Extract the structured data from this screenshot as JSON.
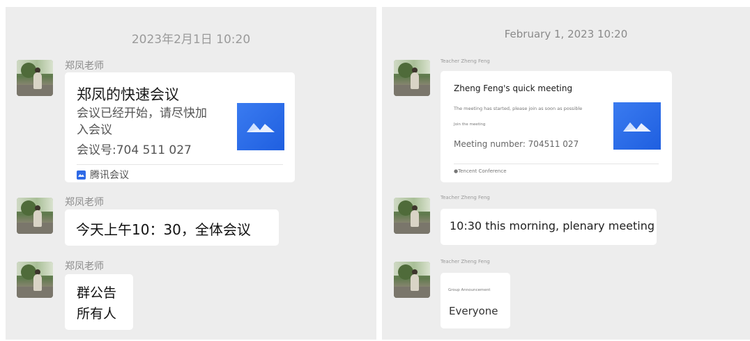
{
  "left": {
    "timestamp": "2023年2月1日 10:20",
    "sender": "郑凤老师",
    "card": {
      "title": "郑凤的快速会议",
      "desc_line1": "会议已经开始，请尽快加",
      "desc_line2": "入会议",
      "number": "会议号:704 511 027",
      "source": "腾讯会议",
      "logo_icon": "tencent-meeting-logo"
    },
    "msg2": "今天上午10：30，全体会议",
    "msg3_line1": "群公告",
    "msg3_line2": "所有人"
  },
  "right": {
    "timestamp": "February 1, 2023 10:20",
    "sender": "Teacher Zheng Feng",
    "card": {
      "title": "Zheng Feng's quick meeting",
      "desc": "The meeting has started, please join as soon as possible",
      "join": "Join the meeting",
      "number": "Meeting number: 704511 027",
      "source": "●Tencent Conference",
      "logo_icon": "tencent-meeting-logo"
    },
    "msg2": "10:30 this morning, plenary meeting",
    "msg3_small": "Group Announcement",
    "msg3_main": "Everyone"
  },
  "colors": {
    "panel_bg": "#ededed",
    "bubble_bg": "#ffffff",
    "brand_blue": "#2f6ae6"
  }
}
